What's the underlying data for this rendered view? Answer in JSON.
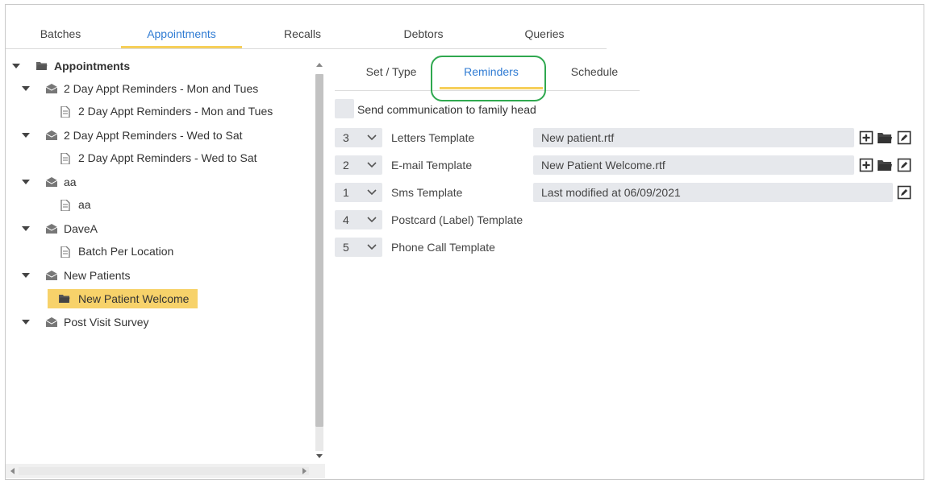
{
  "top_tabs": [
    {
      "label": "Batches"
    },
    {
      "label": "Appointments"
    },
    {
      "label": "Recalls"
    },
    {
      "label": "Debtors"
    },
    {
      "label": "Queries"
    }
  ],
  "tree": {
    "root_label": "Appointments",
    "groups": [
      {
        "label": "2 Day Appt Reminders - Mon and Tues",
        "child": "2 Day Appt Reminders - Mon and Tues"
      },
      {
        "label": "2 Day Appt Reminders - Wed to Sat",
        "child": "2 Day Appt Reminders - Wed to Sat"
      },
      {
        "label": "aa",
        "child": "aa"
      },
      {
        "label": "DaveA",
        "child": "Batch Per Location"
      },
      {
        "label": "New Patients",
        "child": "New Patient Welcome"
      },
      {
        "label": "Post Visit Survey"
      }
    ],
    "selected_color": "#f7d26a"
  },
  "sub_tabs": [
    {
      "label": "Set / Type"
    },
    {
      "label": "Reminders"
    },
    {
      "label": "Schedule"
    }
  ],
  "send_to_family_head": {
    "label": "Send communication to family head",
    "checked": false
  },
  "templates": [
    {
      "order": "3",
      "label": "Letters Template",
      "file": "New patient.rtf"
    },
    {
      "order": "2",
      "label": "E-mail Template",
      "file": "New Patient Welcome.rtf"
    },
    {
      "order": "1",
      "label": "Sms Template",
      "file": "Last modified at 06/09/2021"
    },
    {
      "order": "4",
      "label": "Postcard (Label) Template"
    },
    {
      "order": "5",
      "label": "Phone Call Template"
    }
  ],
  "colors": {
    "accent": "#2f7bd3",
    "underline": "#f6cf5a",
    "annotation_ring": "#2fa84f",
    "field_bg": "#e6e8ec"
  }
}
